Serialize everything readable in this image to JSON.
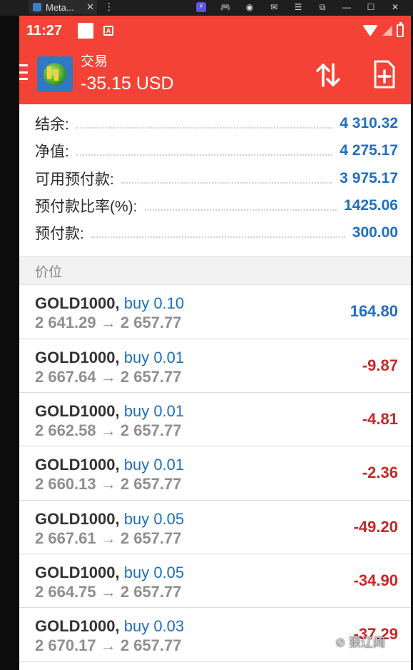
{
  "host": {
    "tab_title": "Meta...",
    "tab_close": "✕",
    "more": "⋮",
    "tools": [
      "⚡",
      "🎮",
      "◉",
      "✉",
      "☰",
      "⧉",
      "—",
      "☐",
      "✕"
    ]
  },
  "status_bar": {
    "time": "11:27",
    "indicator": "A"
  },
  "app_bar": {
    "title": "交易",
    "profit": "-35.15 USD"
  },
  "summary": [
    {
      "label": "结余:",
      "value": "4 310.32"
    },
    {
      "label": "净值:",
      "value": "4 275.17"
    },
    {
      "label": "可用预付款:",
      "value": "3 975.17"
    },
    {
      "label": "预付款比率(%):",
      "value": "1425.06"
    },
    {
      "label": "预付款:",
      "value": "300.00"
    }
  ],
  "section_label": "价位",
  "positions": [
    {
      "symbol": "GOLD1000,",
      "side": "buy 0.10",
      "prices": "2 641.29 → 2 657.77",
      "profit": "164.80",
      "sign": "pos"
    },
    {
      "symbol": "GOLD1000,",
      "side": "buy 0.01",
      "prices": "2 667.64 → 2 657.77",
      "profit": "-9.87",
      "sign": "neg"
    },
    {
      "symbol": "GOLD1000,",
      "side": "buy 0.01",
      "prices": "2 662.58 → 2 657.77",
      "profit": "-4.81",
      "sign": "neg"
    },
    {
      "symbol": "GOLD1000,",
      "side": "buy 0.01",
      "prices": "2 660.13 → 2 657.77",
      "profit": "-2.36",
      "sign": "neg"
    },
    {
      "symbol": "GOLD1000,",
      "side": "buy 0.05",
      "prices": "2 667.61 → 2 657.77",
      "profit": "-49.20",
      "sign": "neg"
    },
    {
      "symbol": "GOLD1000,",
      "side": "buy 0.05",
      "prices": "2 664.75 → 2 657.77",
      "profit": "-34.90",
      "sign": "neg"
    },
    {
      "symbol": "GOLD1000,",
      "side": "buy 0.03",
      "prices": "2 670.17 → 2 657.77",
      "profit": "-37.29",
      "sign": "neg"
    }
  ],
  "watermark": "⊘ 狠辽阔",
  "colors": {
    "accent_red": "#f44336",
    "profit_blue": "#1e6fbf",
    "loss_red": "#c62828"
  }
}
